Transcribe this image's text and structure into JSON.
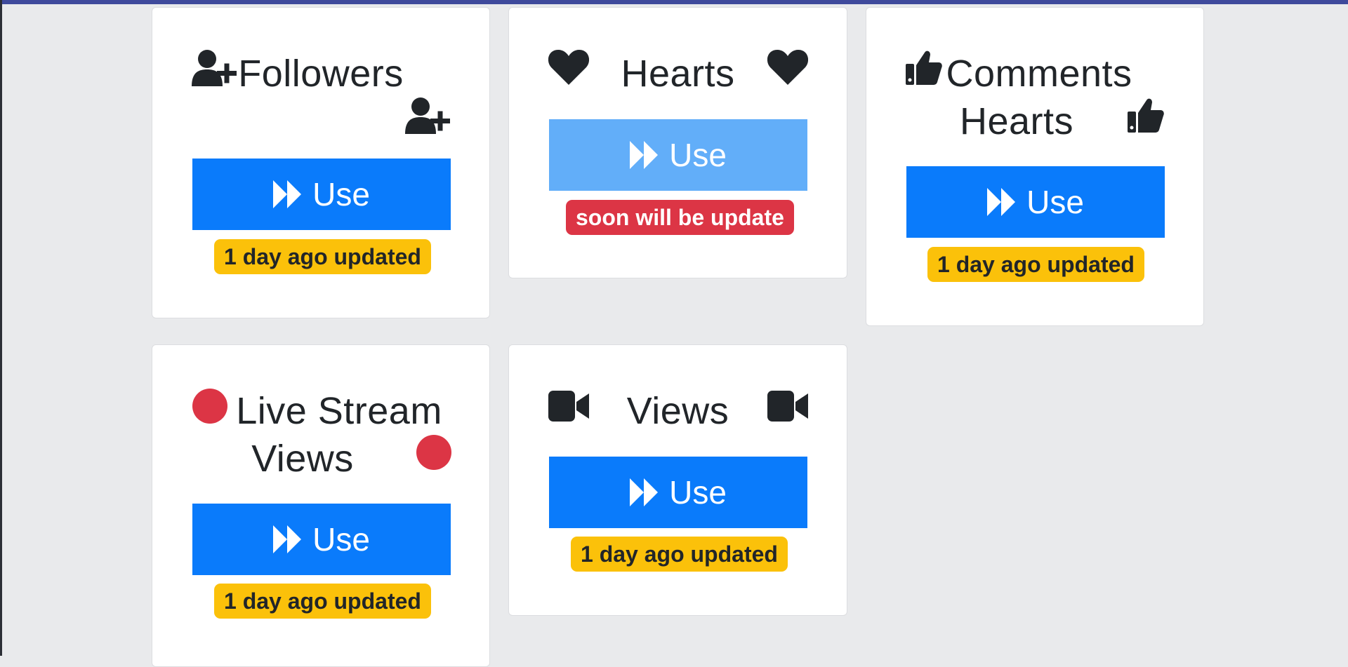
{
  "cards": [
    {
      "title_lines": [
        "Followers"
      ],
      "icon": "user-plus-icon",
      "button_label": "Use",
      "button_icon": "fast-forward-icon",
      "button_disabled": false,
      "badge": "1 day ago updated",
      "badge_style": "warning"
    },
    {
      "title_lines": [
        "Hearts"
      ],
      "icon": "heart-icon",
      "button_label": "Use",
      "button_icon": "fast-forward-icon",
      "button_disabled": true,
      "badge": "soon will be update",
      "badge_style": "danger"
    },
    {
      "title_lines": [
        "Comments",
        "Hearts"
      ],
      "icon": "thumbs-up-icon",
      "button_label": "Use",
      "button_icon": "fast-forward-icon",
      "button_disabled": false,
      "badge": "1 day ago updated",
      "badge_style": "warning"
    },
    {
      "title_lines": [
        "Live Stream",
        "Views"
      ],
      "icon": "red-circle-icon",
      "button_label": "Use",
      "button_icon": "fast-forward-icon",
      "button_disabled": false,
      "badge": "1 day ago updated",
      "badge_style": "warning"
    },
    {
      "title_lines": [
        "Views"
      ],
      "icon": "video-camera-icon",
      "button_label": "Use",
      "button_icon": "fast-forward-icon",
      "button_disabled": false,
      "badge": "1 day ago updated",
      "badge_style": "warning"
    }
  ],
  "colors": {
    "primary": "#0a7bfb",
    "primary_disabled": "#62aef9",
    "warning": "#fbc10a",
    "danger": "#dc3545",
    "live_dot": "#dc3545",
    "text": "#212529",
    "page_bg": "#e9eaec"
  }
}
